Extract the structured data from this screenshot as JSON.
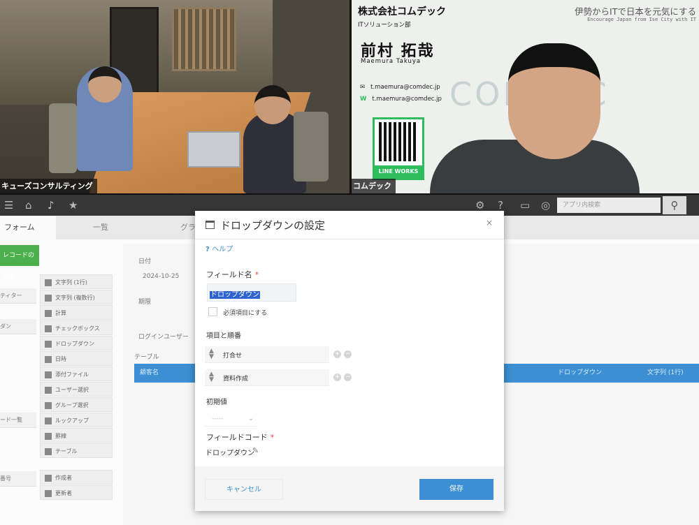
{
  "video": {
    "left_label": "キューズコンサルティング",
    "right_label": "コムデック",
    "card": {
      "company": "株式会社コムデック",
      "department": "ITソリューション部",
      "name_jp": "前村 拓哉",
      "name_romaji": "Maemura Takuya",
      "slogan": "伊勢からITで日本を元気にする",
      "slogan_en": "Encourage Japan from Ise City with IT",
      "email": "t.maemura@comdec.jp",
      "lineworks_id": "t.maemura@comdec.jp",
      "qr_caption": "LINE WORKS",
      "logo_text": "COMDEC"
    }
  },
  "app": {
    "search_placeholder": "アプリ内検索",
    "tabs": [
      "フォーム",
      "一覧",
      "グラフ"
    ],
    "add_button": "レコードの追加",
    "sidebar_left": [
      "ティター",
      "ダン",
      "ード一覧",
      "番号"
    ],
    "palette": [
      "文字列 (1行)",
      "文字列 (複数行)",
      "計算",
      "チェックボックス",
      "ドロップダウン",
      "日時",
      "添付ファイル",
      "ユーザー選択",
      "グループ選択",
      "ルックアップ",
      "罫線",
      "テーブル",
      "作成者",
      "更新者"
    ],
    "form": {
      "date_label": "日付",
      "date_value": "2024-10-25",
      "area_label": "期限",
      "section_label": "ログインユーザー",
      "table_label": "テーブル",
      "table_headers": [
        "顧客名",
        "ドロップダウン",
        "文字列 (1行)"
      ]
    }
  },
  "modal": {
    "title": "ドロップダウンの設定",
    "help": "ヘルプ",
    "field_name_label": "フィールド名",
    "field_name_value": "ドロップダウン",
    "required_checkbox": "必須項目にする",
    "items_label": "項目と順番",
    "options": [
      "打合せ",
      "資料作成"
    ],
    "default_label": "初期値",
    "default_value": "-----",
    "field_code_label": "フィールドコード",
    "field_code_value": "ドロップダウン",
    "cancel": "キャンセル",
    "save": "保存"
  },
  "colors": {
    "accent_blue": "#3b8fd2",
    "add_green": "#4bb04b",
    "header_dark": "#373737",
    "lineworks_green": "#2dbd5c"
  }
}
